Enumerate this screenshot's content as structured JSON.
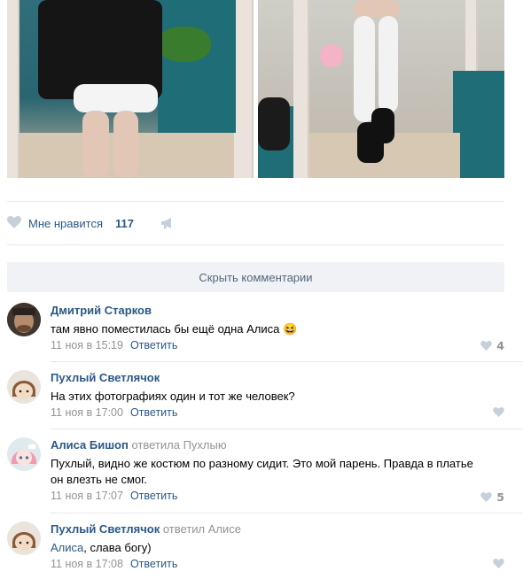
{
  "post": {
    "like_label": "Мне нравится",
    "like_count": "117",
    "hide_comments_label": "Скрыть комментарии"
  },
  "comments": [
    {
      "author": "Дмитрий Старков",
      "reply_to": "",
      "text": "там явно поместилась бы ещё одна Алиса",
      "emoji": "😆",
      "date": "11 ноя в 15:19",
      "answer_label": "Ответить",
      "likes": "4"
    },
    {
      "author": "Пухлый Светлячок",
      "reply_to": "",
      "text": "На этих фотографиях один и тот же человек?",
      "date": "11 ноя в 17:00",
      "answer_label": "Ответить",
      "likes": ""
    },
    {
      "author": "Алиса Бишоп",
      "reply_to": "ответила Пухлыю",
      "text": "Пухлый, видно же костюм по разному сидит. Это мой парень. Правда в платье он влезть не смог.",
      "date": "11 ноя в 17:07",
      "answer_label": "Ответить",
      "likes": "5"
    },
    {
      "author": "Пухлый Светлячок",
      "reply_to": "ответил Алисе",
      "text_link": "Алиса",
      "text": ", слава богу)",
      "date": "11 ноя в 17:08",
      "answer_label": "Ответить",
      "likes": ""
    }
  ],
  "icons": {
    "like": "heart-icon",
    "share": "megaphone-icon"
  },
  "colors": {
    "link": "#2a5885",
    "meta": "#939393",
    "heart": "#c5d0db",
    "button_bg": "#f0f2f5",
    "button_text": "#55677d"
  }
}
